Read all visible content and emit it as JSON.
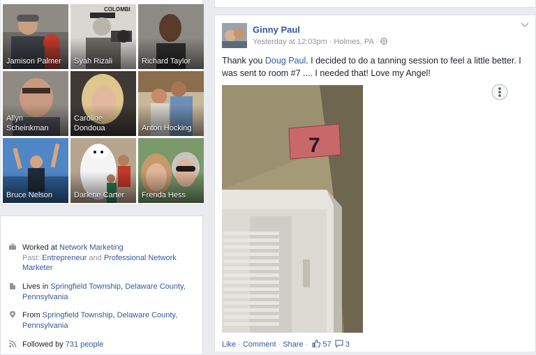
{
  "friends": [
    {
      "name": "Jamison Palmer"
    },
    {
      "name": "Syah Rizali"
    },
    {
      "name": "Richard Taylor"
    },
    {
      "name": "Allyn Scheinkman"
    },
    {
      "name": "Caroline Dondoua"
    },
    {
      "name": "Anton Hocking"
    },
    {
      "name": "Bruce Nelson"
    },
    {
      "name": "Darlene Carter"
    },
    {
      "name": "Frenda Hess"
    }
  ],
  "photo_text": {
    "colombia": "COLOMBI"
  },
  "intro": {
    "work": {
      "prefix": "Worked at",
      "employer": "Network Marketing",
      "past_label": "Past:",
      "past1": "Entrepreneur",
      "and": "and",
      "past2": "Professional Network Marketer"
    },
    "lives": {
      "prefix": "Lives in",
      "place1": "Springfield Township",
      "place2": "Delaware County, Pennsylvania"
    },
    "from": {
      "prefix": "From",
      "place1": "Springfield Township",
      "place2": "Delaware County, Pennsylvania"
    },
    "followed": {
      "prefix": "Followed by",
      "count": "731 people"
    }
  },
  "post": {
    "author": "Ginny Paul",
    "time": "Yesterday at 12:03pm",
    "location": "Holmes, PA",
    "text_before": "Thank you ",
    "mention": "Doug Paul",
    "text_after": ". I decided to do a tanning session to feel a little better. I was sent to room #7 .... I needed that! Love my Angel!",
    "room_number": "7",
    "actions": {
      "like": "Like",
      "comment": "Comment",
      "share": "Share",
      "likes_count": "57",
      "comments_count": "3"
    }
  },
  "colors": {
    "link": "#365899",
    "muted": "#90949c",
    "background": "#e9ebee"
  }
}
